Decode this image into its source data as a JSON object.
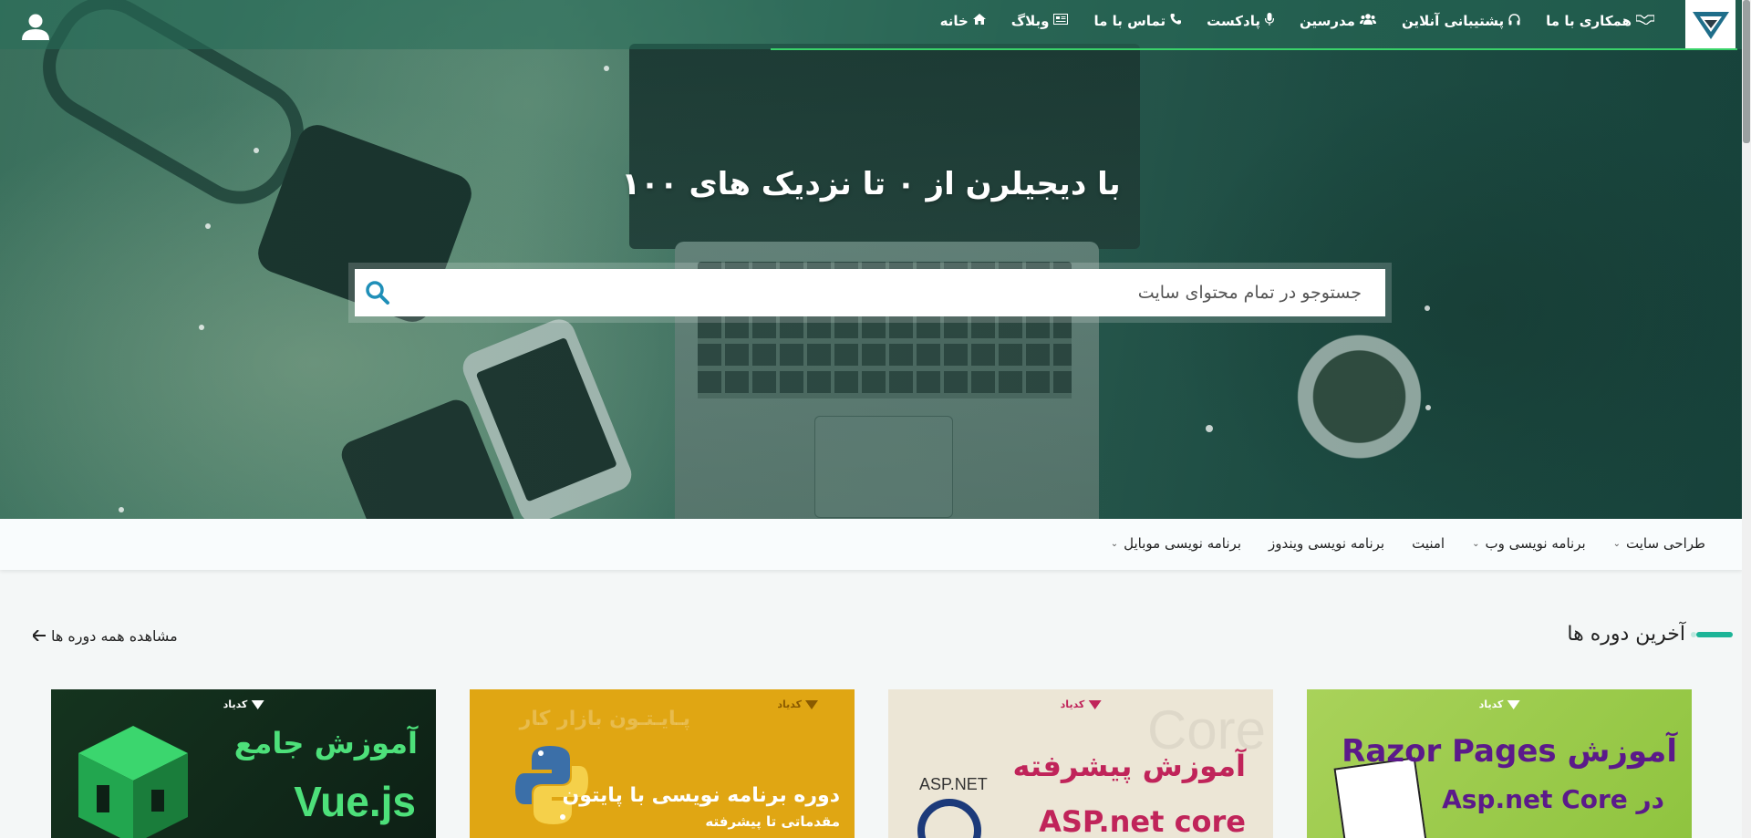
{
  "header": {
    "nav": [
      {
        "label": "خانه",
        "icon": "home-icon"
      },
      {
        "label": "وبلاگ",
        "icon": "newspaper-icon"
      },
      {
        "label": "تماس با ما",
        "icon": "phone-icon"
      },
      {
        "label": "پادکست",
        "icon": "microphone-icon"
      },
      {
        "label": "مدرسین",
        "icon": "users-icon"
      },
      {
        "label": "پشتیبانی آنلاین",
        "icon": "headphones-icon"
      },
      {
        "label": "همکاری با ما",
        "icon": "handshake-icon"
      }
    ]
  },
  "hero": {
    "title": "با دیجیلرن از ۰ تا نزدیک های ۱۰۰",
    "search_placeholder": "جستوجو در تمام محتوای سایت"
  },
  "categories": [
    {
      "label": "طراحی سایت",
      "dropdown": true
    },
    {
      "label": "برنامه نویسی وب",
      "dropdown": true
    },
    {
      "label": "امنیت",
      "dropdown": false
    },
    {
      "label": "برنامه نویسی ویندوز",
      "dropdown": false
    },
    {
      "label": "برنامه نویسی موبایل",
      "dropdown": true
    }
  ],
  "latest": {
    "title": "آخرین دوره ها",
    "view_all": "مشاهده همه دوره ها"
  },
  "cards": {
    "brand": "کدیاد",
    "razor": {
      "line1": "آموزش Razor Pages",
      "line2": "در Asp.net Core"
    },
    "asp": {
      "line1": "آموزش پیشرفته",
      "line2": "ASP.net core",
      "logo_text": "ASP.NET",
      "bg_text": "Core"
    },
    "python": {
      "line1": "دوره برنامه نویسی با پایتون",
      "line2": "مقدماتی تا پیشرفته",
      "bg_text": "پـایـتـون بازار کار"
    },
    "vue": {
      "line1": "آموزش جامع",
      "line2": "Vue.js"
    }
  },
  "colors": {
    "accent": "#1cb497",
    "nav_underline": "#3ad26a",
    "search_icon": "#1f8fb8"
  }
}
